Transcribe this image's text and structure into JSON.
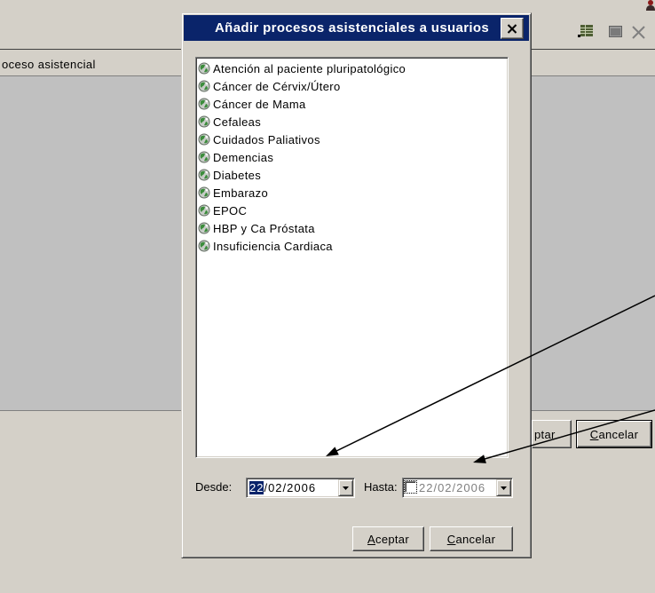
{
  "colors": {
    "window_face": "#D4D0C8",
    "title_bar": "#0A246A",
    "selection": "#0A246A",
    "disabled_text": "#808080",
    "list_background": "#FFFFFF",
    "annotation_arrows": "#000000"
  },
  "background_window": {
    "toolbar_icons": [
      "person-icon",
      "table-icon",
      "window-icon",
      "close-icon"
    ],
    "list_header": "oceso asistencial",
    "accept_button_partial": "ptar",
    "cancel_button": "Cancelar"
  },
  "dialog": {
    "title": "Añadir procesos asistenciales a usuarios",
    "close_icon": "close-icon",
    "items": [
      {
        "label": "Atención al paciente pluripatológico",
        "icon": "process-icon"
      },
      {
        "label": "Cáncer de Cérvix/Útero",
        "icon": "process-icon"
      },
      {
        "label": "Cáncer de Mama",
        "icon": "process-icon"
      },
      {
        "label": "Cefaleas",
        "icon": "process-icon"
      },
      {
        "label": "Cuidados Paliativos",
        "icon": "process-icon"
      },
      {
        "label": "Demencias",
        "icon": "process-icon"
      },
      {
        "label": "Diabetes",
        "icon": "process-icon"
      },
      {
        "label": "Embarazo",
        "icon": "process-icon"
      },
      {
        "label": "EPOC",
        "icon": "process-icon"
      },
      {
        "label": "HBP y Ca Próstata",
        "icon": "process-icon"
      },
      {
        "label": "Insuficiencia Cardiaca",
        "icon": "process-icon"
      }
    ],
    "from": {
      "label": "Desde:",
      "day_selected": "22",
      "month_year": "/02/2006"
    },
    "to": {
      "label": "Hasta:",
      "checkbox_checked": false,
      "enabled": false,
      "value": "22/02/2006"
    },
    "accept_button": "Aceptar",
    "cancel_button": "Cancelar"
  }
}
